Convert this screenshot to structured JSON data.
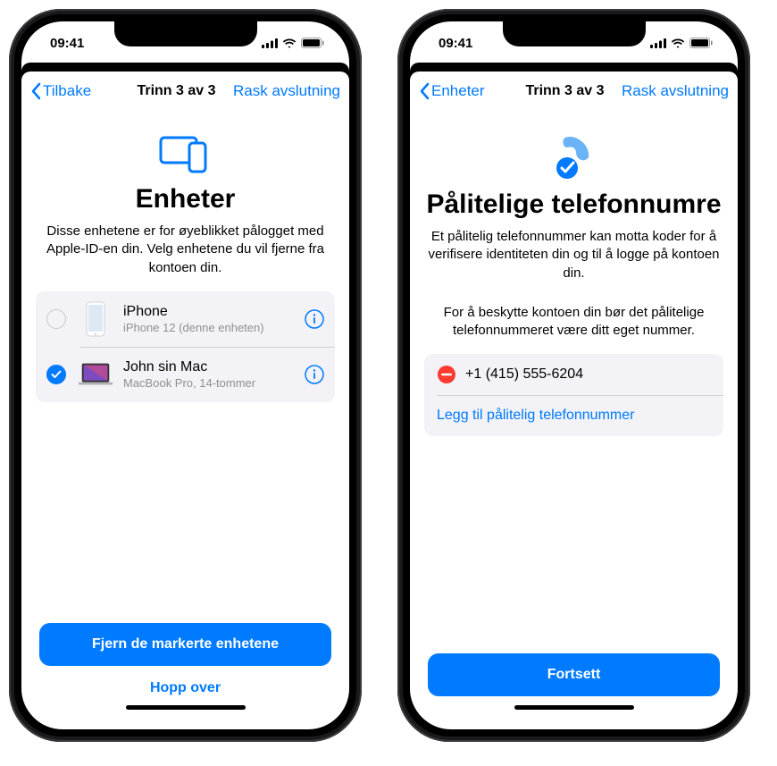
{
  "status": {
    "time": "09:41"
  },
  "left": {
    "nav": {
      "back": "Tilbake",
      "title": "Trinn 3 av 3",
      "right": "Rask avslutning"
    },
    "title": "Enheter",
    "desc": "Disse enhetene er for øyeblikket pålogget med Apple-ID-en din. Velg enhetene du vil fjerne fra kontoen din.",
    "devices": [
      {
        "name": "iPhone",
        "sub": "iPhone 12 (denne enheten)"
      },
      {
        "name": "John sin Mac",
        "sub": "MacBook Pro, 14-tommer"
      }
    ],
    "primary": "Fjern de markerte enhetene",
    "secondary": "Hopp over"
  },
  "right": {
    "nav": {
      "back": "Enheter",
      "title": "Trinn 3 av 3",
      "right": "Rask avslutning"
    },
    "title": "Pålitelige telefonnumre",
    "desc1": "Et pålitelig telefonnummer kan motta koder for å verifisere identiteten din og til å logge på kontoen din.",
    "desc2": "For å beskytte kontoen din bør det pålitelige telefonnummeret være ditt eget nummer.",
    "phone": "+1 (415) 555-6204",
    "add": "Legg til pålitelig telefonnummer",
    "primary": "Fortsett"
  }
}
